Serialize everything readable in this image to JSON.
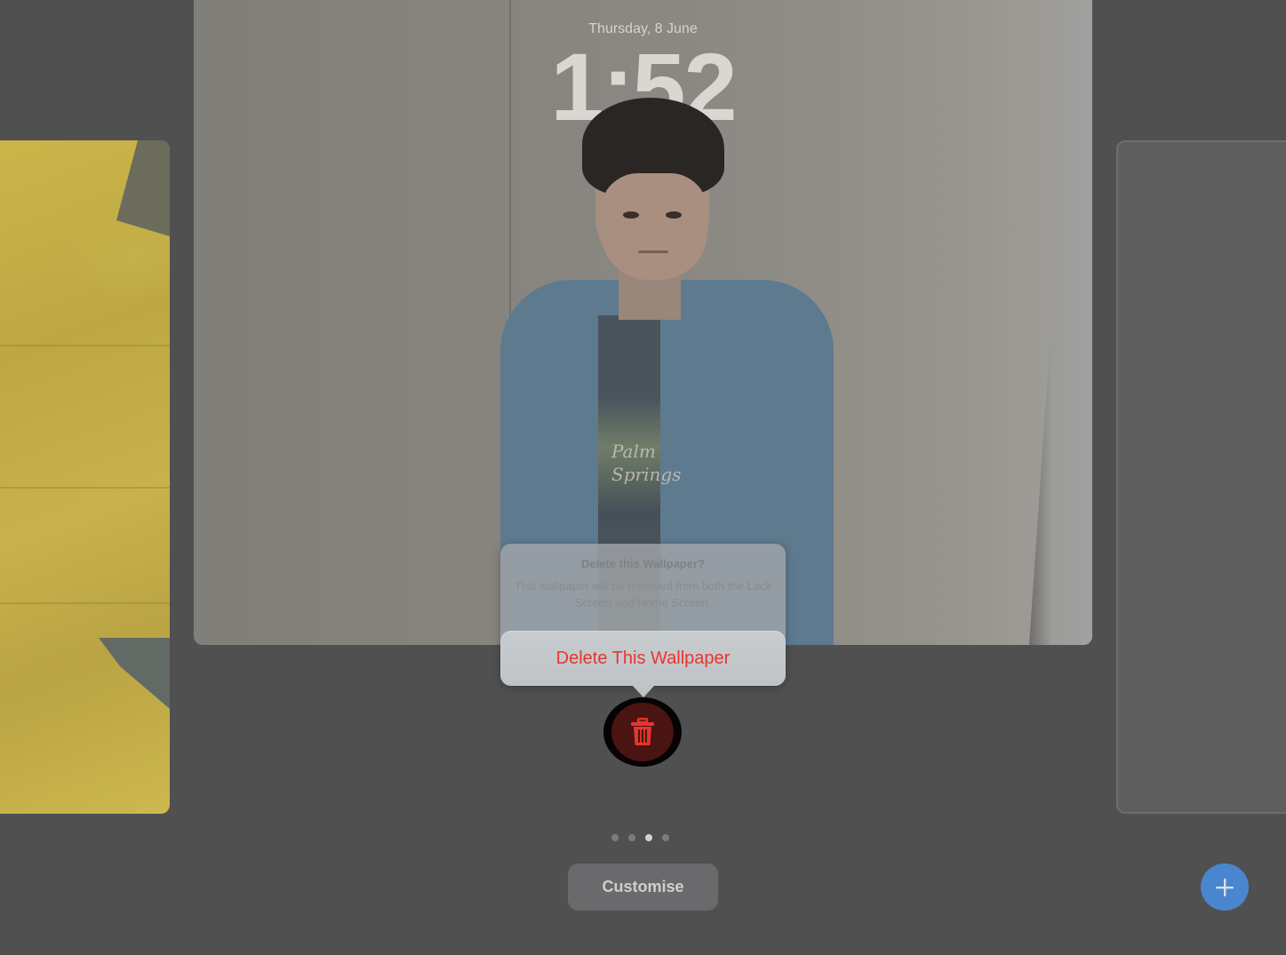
{
  "lock_screen": {
    "date": "Thursday, 8 June",
    "time": "1:52",
    "tee_text": [
      "Palm",
      "Springs"
    ]
  },
  "alert": {
    "title": "Delete this Wallpaper?",
    "message": "This wallpaper will be removed from both the Lock Screen and Home Screen.",
    "destructive_action": "Delete This Wallpaper"
  },
  "controls": {
    "trash_icon": "trash-icon",
    "customise_label": "Customise",
    "add_icon": "plus-icon",
    "page_count": 4,
    "current_page": 3
  },
  "colors": {
    "destructive": "#e8352d",
    "accent": "#4a86cf",
    "background": "#505050"
  }
}
